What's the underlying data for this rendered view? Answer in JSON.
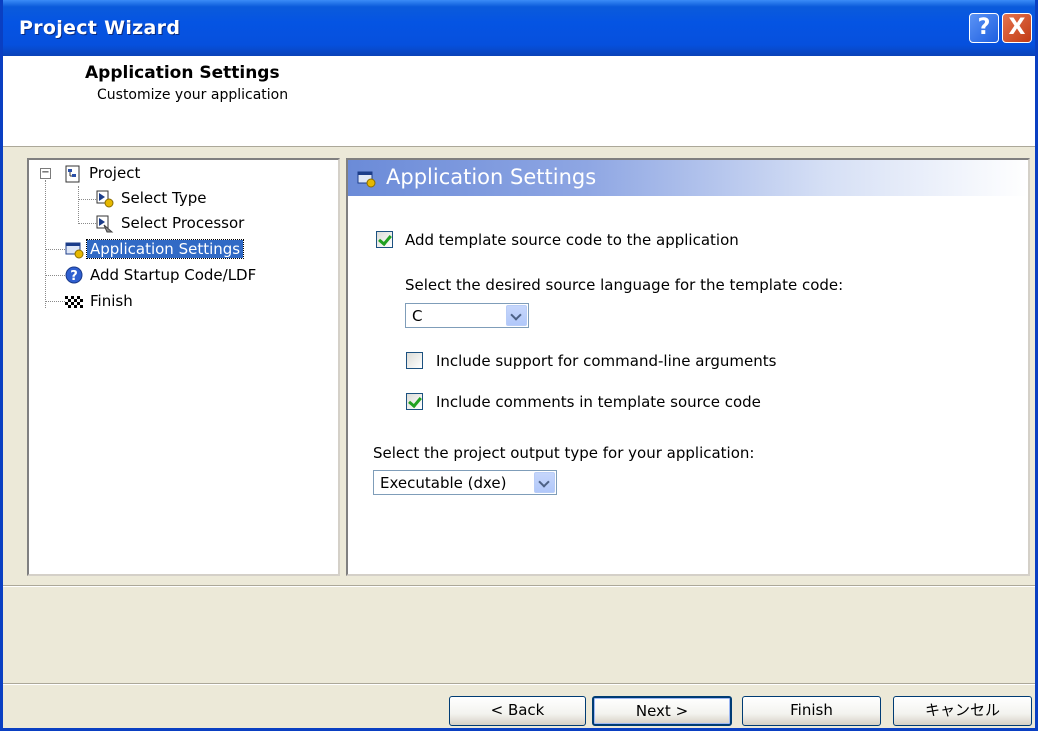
{
  "window": {
    "title": "Project Wizard",
    "help_label": "?",
    "close_label": "X"
  },
  "header": {
    "title": "Application Settings",
    "subtitle": "Customize your application"
  },
  "tree": {
    "items": [
      {
        "label": "Project",
        "icon": "project-icon"
      },
      {
        "label": "Select Type",
        "icon": "select-type-icon"
      },
      {
        "label": "Select Processor",
        "icon": "select-processor-icon"
      },
      {
        "label": "Application Settings",
        "icon": "application-settings-icon",
        "selected": true
      },
      {
        "label": "Add Startup Code/LDF",
        "icon": "question-icon"
      },
      {
        "label": "Finish",
        "icon": "checkered-flag-icon"
      }
    ]
  },
  "panel": {
    "title": "Application Settings",
    "add_template": {
      "label": "Add template source code to the application",
      "checked": true
    },
    "language_prompt": "Select the desired source language for the template code:",
    "language_value": "C",
    "cmdline": {
      "label": "Include support for command-line arguments",
      "checked": false
    },
    "comments": {
      "label": "Include comments in template source code",
      "checked": true
    },
    "output_prompt": "Select the project output type for your application:",
    "output_value": "Executable (dxe)"
  },
  "buttons": {
    "back": "< Back",
    "next": "Next >",
    "finish": "Finish",
    "cancel": "キャンセル"
  },
  "colors": {
    "titlebar": "#0554e3",
    "selection": "#316ac5",
    "dialog_bg": "#ece9d8"
  }
}
